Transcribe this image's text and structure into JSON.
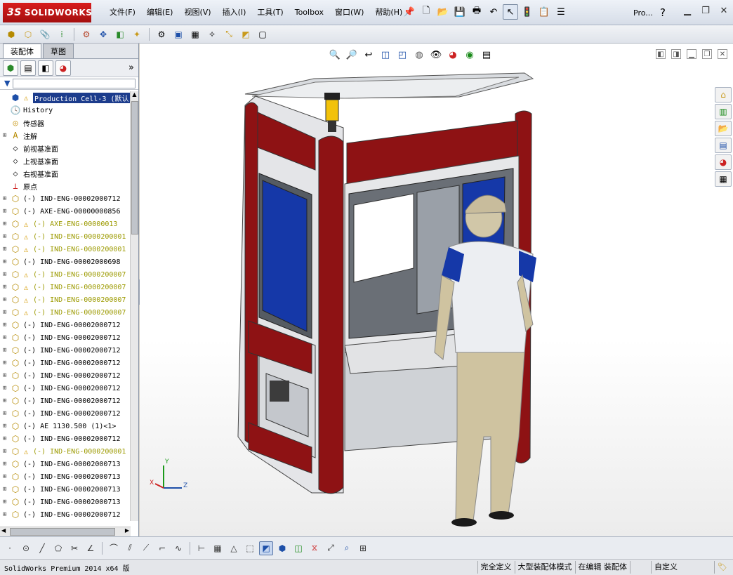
{
  "app": {
    "logo_mark": "3S",
    "logo_text": "SOLIDWORKS"
  },
  "menu": [
    {
      "label": "文件(F)"
    },
    {
      "label": "编辑(E)"
    },
    {
      "label": "视图(V)"
    },
    {
      "label": "插入(I)"
    },
    {
      "label": "工具(T)"
    },
    {
      "label": "Toolbox"
    },
    {
      "label": "窗口(W)"
    },
    {
      "label": "帮助(H)"
    }
  ],
  "title_right": {
    "search_label": "Pro...",
    "help_label": "?"
  },
  "feature_manager": {
    "tabs": [
      {
        "label": "装配体",
        "active": true
      },
      {
        "label": "草图",
        "active": false
      }
    ],
    "tree": [
      {
        "label": "Production Cell-3 (默认",
        "kind": "root",
        "warn": true,
        "selected": true
      },
      {
        "label": "History",
        "kind": "history"
      },
      {
        "label": "传感器",
        "kind": "sensor"
      },
      {
        "label": "注解",
        "kind": "annotation"
      },
      {
        "label": "前视基准面",
        "kind": "plane"
      },
      {
        "label": "上视基准面",
        "kind": "plane"
      },
      {
        "label": "右视基准面",
        "kind": "plane"
      },
      {
        "label": "原点",
        "kind": "origin"
      },
      {
        "label": "(-) IND-ENG-00002000712",
        "kind": "comp"
      },
      {
        "label": "(-) AXE-ENG-00000000856",
        "kind": "comp"
      },
      {
        "label": "(-) AXE-ENG-00000013",
        "kind": "comp",
        "warn": true,
        "yellow": true
      },
      {
        "label": "(-) IND-ENG-0000200001",
        "kind": "comp",
        "warn": true,
        "yellow": true
      },
      {
        "label": "(-) IND-ENG-0000200001",
        "kind": "comp",
        "warn": true,
        "yellow": true
      },
      {
        "label": "(-) IND-ENG-00002000698",
        "kind": "comp"
      },
      {
        "label": "(-) IND-ENG-0000200007",
        "kind": "comp",
        "warn": true,
        "yellow": true
      },
      {
        "label": "(-) IND-ENG-0000200007",
        "kind": "comp",
        "warn": true,
        "yellow": true
      },
      {
        "label": "(-) IND-ENG-0000200007",
        "kind": "comp",
        "warn": true,
        "yellow": true
      },
      {
        "label": "(-) IND-ENG-0000200007",
        "kind": "comp",
        "warn": true,
        "yellow": true
      },
      {
        "label": "(-) IND-ENG-00002000712",
        "kind": "comp"
      },
      {
        "label": "(-) IND-ENG-00002000712",
        "kind": "comp"
      },
      {
        "label": "(-) IND-ENG-00002000712",
        "kind": "comp"
      },
      {
        "label": "(-) IND-ENG-00002000712",
        "kind": "comp"
      },
      {
        "label": "(-) IND-ENG-00002000712",
        "kind": "comp"
      },
      {
        "label": "(-) IND-ENG-00002000712",
        "kind": "comp"
      },
      {
        "label": "(-) IND-ENG-00002000712",
        "kind": "comp"
      },
      {
        "label": "(-) IND-ENG-00002000712",
        "kind": "comp"
      },
      {
        "label": "(-) AE 1130.500 (1)<1>",
        "kind": "comp"
      },
      {
        "label": "(-) IND-ENG-00002000712",
        "kind": "comp"
      },
      {
        "label": "(-) IND-ENG-0000200001",
        "kind": "comp",
        "warn": true,
        "yellow": true
      },
      {
        "label": "(-) IND-ENG-00002000713",
        "kind": "comp"
      },
      {
        "label": "(-) IND-ENG-00002000713",
        "kind": "comp"
      },
      {
        "label": "(-) IND-ENG-00002000713",
        "kind": "comp"
      },
      {
        "label": "(-) IND-ENG-00002000713",
        "kind": "comp"
      },
      {
        "label": "(-) IND-ENG-00002000712",
        "kind": "comp"
      }
    ]
  },
  "triad": {
    "x": "X",
    "y": "Y",
    "z": "Z"
  },
  "status": {
    "product": "SolidWorks Premium 2014 x64 版",
    "cells": [
      "完全定义",
      "大型装配体模式",
      "在编辑 装配体",
      "",
      "自定义"
    ]
  },
  "colors": {
    "cabinet_red": "#8e1214",
    "panel_blue": "#1538a8",
    "frame_gray": "#9aa0a8",
    "selection": "#1c3c8c",
    "warning": "#d49a00"
  }
}
